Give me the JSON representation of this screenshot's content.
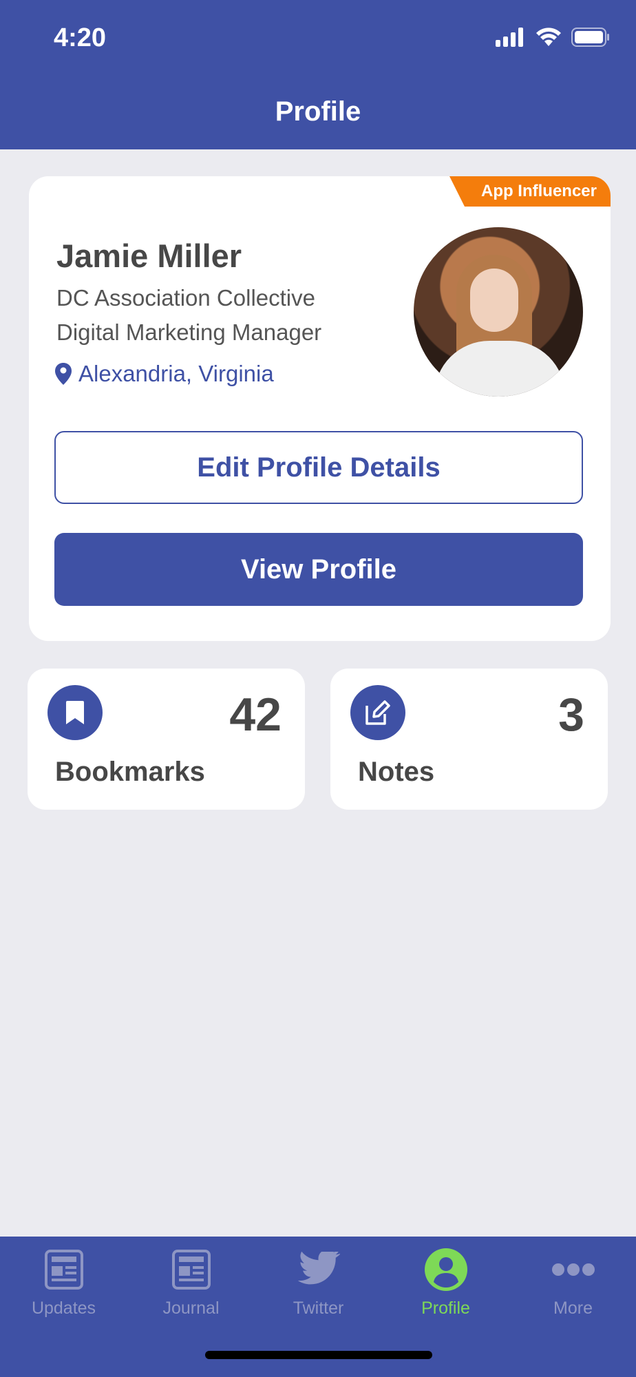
{
  "status_bar": {
    "time": "4:20"
  },
  "header": {
    "title": "Profile"
  },
  "profile": {
    "badge": "App Influencer",
    "name": "Jamie Miller",
    "organization": "DC Association Collective",
    "role": "Digital Marketing Manager",
    "location": "Alexandria, Virginia",
    "edit_button": "Edit Profile Details",
    "view_button": "View Profile"
  },
  "stats": {
    "bookmarks": {
      "count": "42",
      "label": "Bookmarks"
    },
    "notes": {
      "count": "3",
      "label": "Notes"
    }
  },
  "tabbar": {
    "items": [
      {
        "label": "Updates",
        "icon": "newspaper-icon"
      },
      {
        "label": "Journal",
        "icon": "newspaper-icon"
      },
      {
        "label": "Twitter",
        "icon": "twitter-bird-icon"
      },
      {
        "label": "Profile",
        "icon": "user-circle-icon",
        "active": true
      },
      {
        "label": "More",
        "icon": "ellipsis-icon"
      }
    ]
  },
  "colors": {
    "brand": "#3F51A5",
    "badge": "#F47D0C",
    "active_tab": "#7ED957",
    "background": "#EBEBF0"
  }
}
